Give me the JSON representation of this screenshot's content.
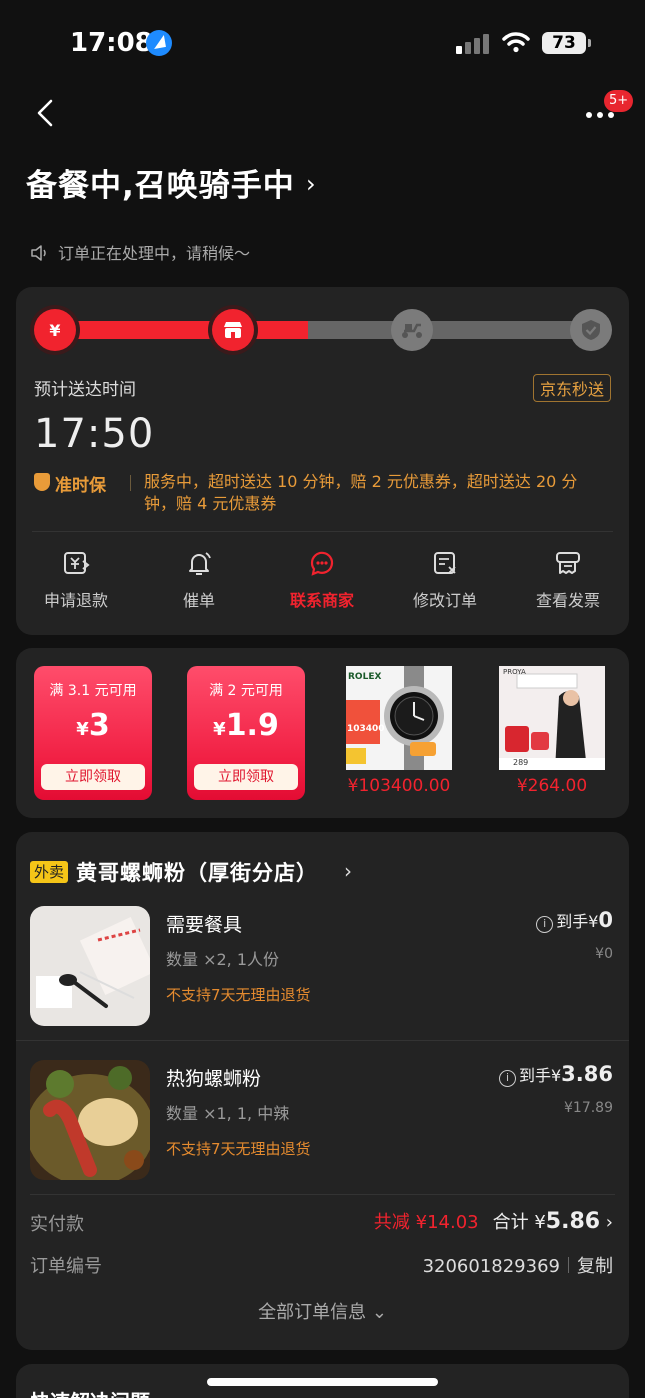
{
  "status_bar": {
    "time": "17:08",
    "battery": "73"
  },
  "header": {
    "badge": "5+",
    "title": "备餐中,召唤骑手中",
    "chevron": "›",
    "notice": "订单正在处理中，请稍候～"
  },
  "progress": {
    "fraction": 0.47,
    "steps": [
      {
        "icon": "yen-icon",
        "glyph": "¥",
        "state": "done"
      },
      {
        "icon": "shop-icon",
        "glyph": "",
        "state": "done"
      },
      {
        "icon": "rider-icon",
        "glyph": "",
        "state": "todo"
      },
      {
        "icon": "check-icon",
        "glyph": "",
        "state": "todo"
      }
    ],
    "eta_label": "预计送达时间",
    "service_tag": "京东秒送",
    "eta_time": "17:50",
    "ontime_label": "准时保",
    "ontime_desc": "服务中，超时送达 10 分钟，赔 2 元优惠券，超时送达 20 分钟，赔 4 元优惠券"
  },
  "actions": [
    {
      "label": "申请退款",
      "icon": "refund-icon",
      "active": false
    },
    {
      "label": "催单",
      "icon": "bell-icon",
      "active": false
    },
    {
      "label": "联系商家",
      "icon": "chat-icon",
      "active": true
    },
    {
      "label": "修改订单",
      "icon": "edit-order-icon",
      "active": false
    },
    {
      "label": "查看发票",
      "icon": "invoice-icon",
      "active": false
    }
  ],
  "promo": {
    "coupons": [
      {
        "condition": "满 3.1 元可用",
        "yen": "¥",
        "amount": "3",
        "button": "立即领取"
      },
      {
        "condition": "满 2 元可用",
        "yen": "¥",
        "amount": "1.9",
        "button": "立即领取"
      }
    ],
    "products": [
      {
        "price": "¥103400.00",
        "brand": "ROLEX",
        "tag": "103400"
      },
      {
        "price": "¥264.00",
        "brand": "PROYA",
        "tag": "289"
      }
    ]
  },
  "order": {
    "store_tag": "外卖",
    "store_name": "黄哥螺蛳粉（厚街分店）",
    "items": [
      {
        "name": "需要餐具",
        "qty": "数量 ×2, 1人份",
        "policy": "不支持7天无理由退货",
        "price_prefix": "到手¥",
        "price": "0",
        "original": "¥0"
      },
      {
        "name": "热狗螺蛳粉",
        "qty": "数量 ×1, 1, 中辣",
        "policy": "不支持7天无理由退货",
        "price_prefix": "到手¥",
        "price": "3.86",
        "original": "¥17.89"
      }
    ],
    "pay_label": "实付款",
    "discount": "共减 ¥14.03",
    "total_prefix": "合计 ¥",
    "total": "5.86",
    "orderno_label": "订单编号",
    "orderno": "320601829369",
    "copy": "复制",
    "all_info": "全部订单信息 ⌄"
  },
  "bottom": {
    "title": "快速解决问题"
  },
  "colors": {
    "accent": "#f1232e",
    "warning": "#e89b39",
    "card": "#232323",
    "background": "#111111"
  }
}
